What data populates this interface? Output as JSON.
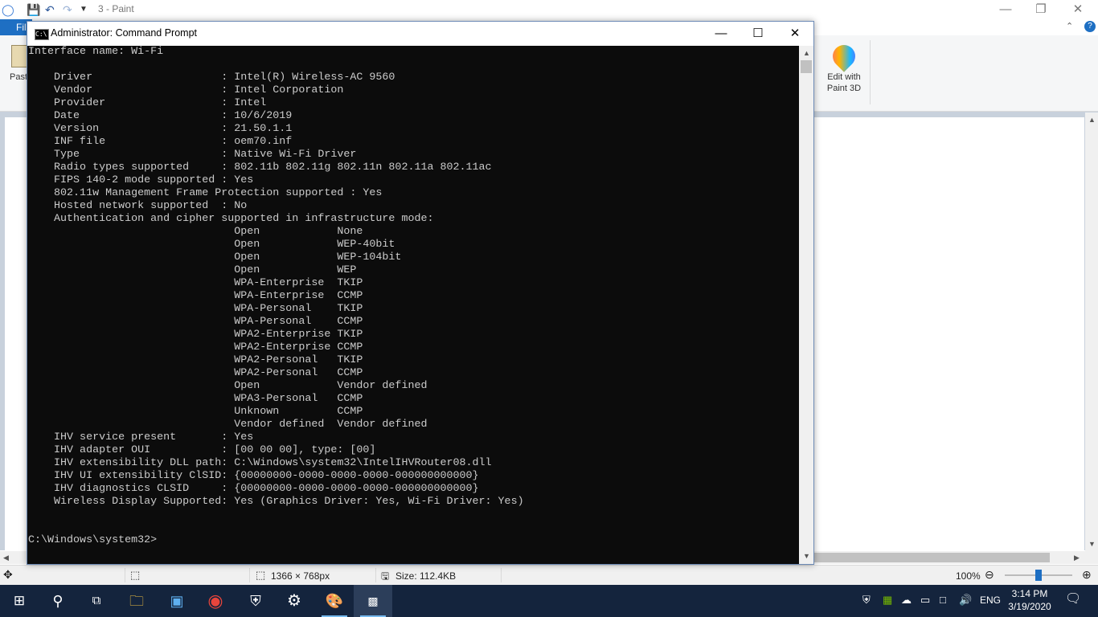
{
  "paint": {
    "title": "3 - Paint",
    "file_tab": "File",
    "paste_label": "Paste",
    "edit_3d_label": "Edit with Paint 3D",
    "status": {
      "dimensions": "1366 × 768px",
      "size": "Size: 112.4KB",
      "zoom": "100%",
      "zoom_fraction": 0.5
    }
  },
  "cmd": {
    "title": "Administrator: Command Prompt",
    "icon_text": "C:\\",
    "lines": [
      "Interface name: Wi-Fi",
      "",
      "    Driver                    : Intel(R) Wireless-AC 9560",
      "    Vendor                    : Intel Corporation",
      "    Provider                  : Intel",
      "    Date                      : 10/6/2019",
      "    Version                   : 21.50.1.1",
      "    INF file                  : oem70.inf",
      "    Type                      : Native Wi-Fi Driver",
      "    Radio types supported     : 802.11b 802.11g 802.11n 802.11a 802.11ac",
      "    FIPS 140-2 mode supported : Yes",
      "    802.11w Management Frame Protection supported : Yes",
      "    Hosted network supported  : No",
      "    Authentication and cipher supported in infrastructure mode:",
      "                                Open            None",
      "                                Open            WEP-40bit",
      "                                Open            WEP-104bit",
      "                                Open            WEP",
      "                                WPA-Enterprise  TKIP",
      "                                WPA-Enterprise  CCMP",
      "                                WPA-Personal    TKIP",
      "                                WPA-Personal    CCMP",
      "                                WPA2-Enterprise TKIP",
      "                                WPA2-Enterprise CCMP",
      "                                WPA2-Personal   TKIP",
      "                                WPA2-Personal   CCMP",
      "                                Open            Vendor defined",
      "                                WPA3-Personal   CCMP",
      "                                Unknown         CCMP",
      "                                Vendor defined  Vendor defined",
      "    IHV service present       : Yes",
      "    IHV adapter OUI           : [00 00 00], type: [00]",
      "    IHV extensibility DLL path: C:\\Windows\\system32\\IntelIHVRouter08.dll",
      "    IHV UI extensibility ClSID: {00000000-0000-0000-0000-000000000000}",
      "    IHV diagnostics CLSID     : {00000000-0000-0000-0000-000000000000}",
      "    Wireless Display Supported: Yes (Graphics Driver: Yes, Wi-Fi Driver: Yes)",
      "",
      "",
      "C:\\Windows\\system32>"
    ]
  },
  "taskbar": {
    "language": "ENG",
    "time": "3:14 PM",
    "date": "3/19/2020",
    "pinned": [
      "start",
      "search",
      "task-view",
      "file-explorer",
      "control-panel",
      "chrome",
      "security",
      "settings",
      "paint",
      "command-prompt"
    ]
  }
}
